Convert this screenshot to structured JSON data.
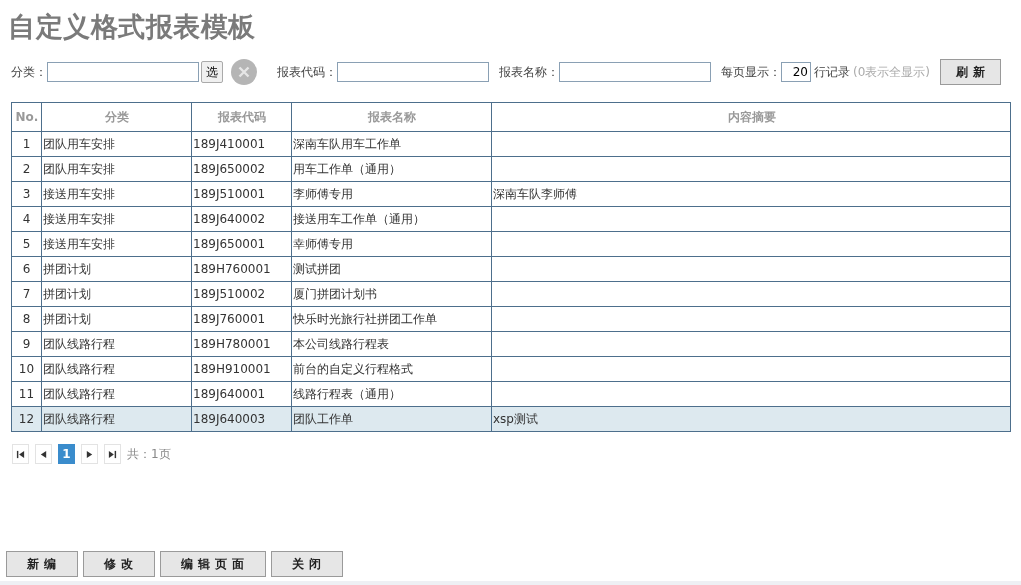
{
  "title": "自定义格式报表模板",
  "filters": {
    "category_label": "分类：",
    "select_button": "选",
    "code_label": "报表代码：",
    "name_label": "报表名称：",
    "per_page_label": "每页显示：",
    "per_page_value": "20",
    "rows_label": "行记录",
    "hint": "(0表示全显示)",
    "refresh_button": "刷新"
  },
  "table": {
    "columns": [
      "No.",
      "分类",
      "报表代码",
      "报表名称",
      "内容摘要"
    ],
    "rows": [
      {
        "no": "1",
        "category": "团队用车安排",
        "code": "189J410001",
        "name": "深南车队用车工作单",
        "summary": "",
        "selected": false
      },
      {
        "no": "2",
        "category": "团队用车安排",
        "code": "189J650002",
        "name": "用车工作单（通用）",
        "summary": "",
        "selected": false
      },
      {
        "no": "3",
        "category": "接送用车安排",
        "code": "189J510001",
        "name": "李师傅专用",
        "summary": "深南车队李师傅",
        "selected": false
      },
      {
        "no": "4",
        "category": "接送用车安排",
        "code": "189J640002",
        "name": "接送用车工作单（通用）",
        "summary": "",
        "selected": false
      },
      {
        "no": "5",
        "category": "接送用车安排",
        "code": "189J650001",
        "name": "幸师傅专用",
        "summary": "",
        "selected": false
      },
      {
        "no": "6",
        "category": "拼团计划",
        "code": "189H760001",
        "name": "测试拼团",
        "summary": "",
        "selected": false
      },
      {
        "no": "7",
        "category": "拼团计划",
        "code": "189J510002",
        "name": "厦门拼团计划书",
        "summary": "",
        "selected": false
      },
      {
        "no": "8",
        "category": "拼团计划",
        "code": "189J760001",
        "name": "快乐时光旅行社拼团工作单",
        "summary": "",
        "selected": false
      },
      {
        "no": "9",
        "category": "团队线路行程",
        "code": "189H780001",
        "name": "本公司线路行程表",
        "summary": "",
        "selected": false
      },
      {
        "no": "10",
        "category": "团队线路行程",
        "code": "189H910001",
        "name": "前台的自定义行程格式",
        "summary": "",
        "selected": false
      },
      {
        "no": "11",
        "category": "团队线路行程",
        "code": "189J640001",
        "name": "线路行程表（通用）",
        "summary": "",
        "selected": false
      },
      {
        "no": "12",
        "category": "团队线路行程",
        "code": "189J640003",
        "name": "团队工作单",
        "summary": "xsp测试",
        "selected": true
      }
    ]
  },
  "pager": {
    "pages": [
      {
        "label": "1",
        "selected": true
      }
    ],
    "total": "共：1页"
  },
  "buttons": [
    "新编",
    "修改",
    "编辑页面",
    "关闭"
  ]
}
